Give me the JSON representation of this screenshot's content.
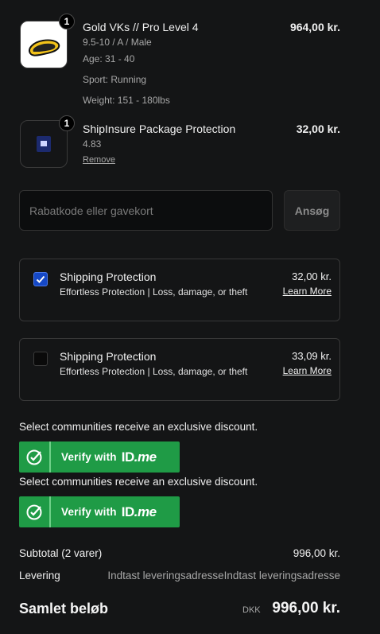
{
  "items": [
    {
      "qty": "1",
      "title": "Gold VKs // Pro Level 4",
      "variant": "9.5-10 / A / Male",
      "age": "Age: 31 - 40",
      "sport": "Sport: Running",
      "weight": "Weight: 151 - 180lbs",
      "price": "964,00 kr."
    },
    {
      "qty": "1",
      "title": "ShipInsure Package Protection",
      "variant": "4.83",
      "remove": "Remove",
      "price": "32,00 kr."
    }
  ],
  "discount": {
    "placeholder": "Rabatkode eller gavekort",
    "apply_label": "Ansøg"
  },
  "protection_options": [
    {
      "checked": true,
      "title": "Shipping Protection",
      "description": "Effortless Protection | Loss, damage, or theft",
      "price": "32,00 kr.",
      "link": "Learn More"
    },
    {
      "checked": false,
      "title": "Shipping Protection",
      "description": "Effortless Protection | Loss, damage, or theft",
      "price": "33,09 kr.",
      "link": "Learn More"
    }
  ],
  "idme": [
    {
      "promo": "Select communities receive an exclusive discount.",
      "label": "Verify with",
      "brand_id": "ID",
      "brand_me": ".me"
    },
    {
      "promo": "Select communities receive an exclusive discount.",
      "label": "Verify with",
      "brand_id": "ID",
      "brand_me": ".me"
    }
  ],
  "summary": {
    "subtotal_label": "Subtotal (2 varer)",
    "subtotal_value": "996,00 kr.",
    "shipping_label": "Levering",
    "shipping_value": "Indtast leveringsadresseIndtast leveringsadresse",
    "total_label": "Samlet beløb",
    "currency": "DKK",
    "total_value": "996,00 kr."
  },
  "colors": {
    "background": "#141516",
    "checkbox_accent": "#1548c6",
    "idme_green": "#1f9b46"
  }
}
